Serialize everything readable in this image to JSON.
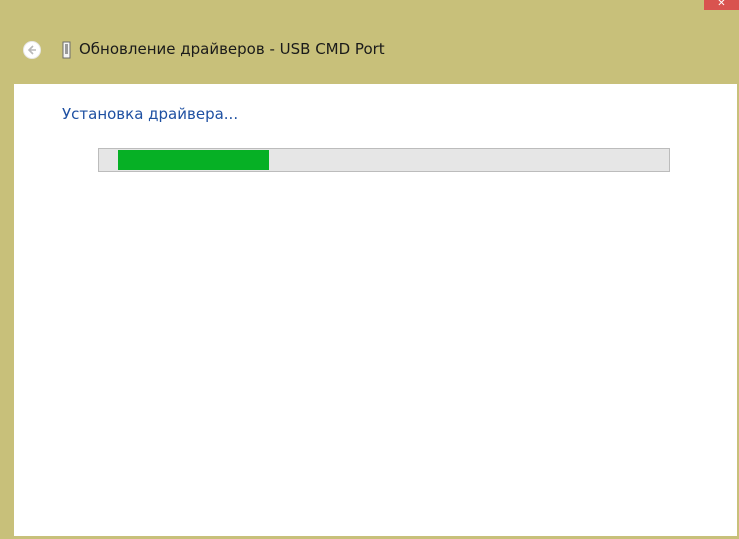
{
  "window": {
    "title": "Обновление драйверов - USB CMD Port",
    "close_label": "✕",
    "accent_color": "#c8c07a"
  },
  "title_bar": {
    "back_icon": "back-arrow-icon",
    "device_icon": "usb-device-icon"
  },
  "content": {
    "status": "Установка драйвера...",
    "progress": {
      "fraction": 0.265,
      "color": "#06b025"
    }
  }
}
